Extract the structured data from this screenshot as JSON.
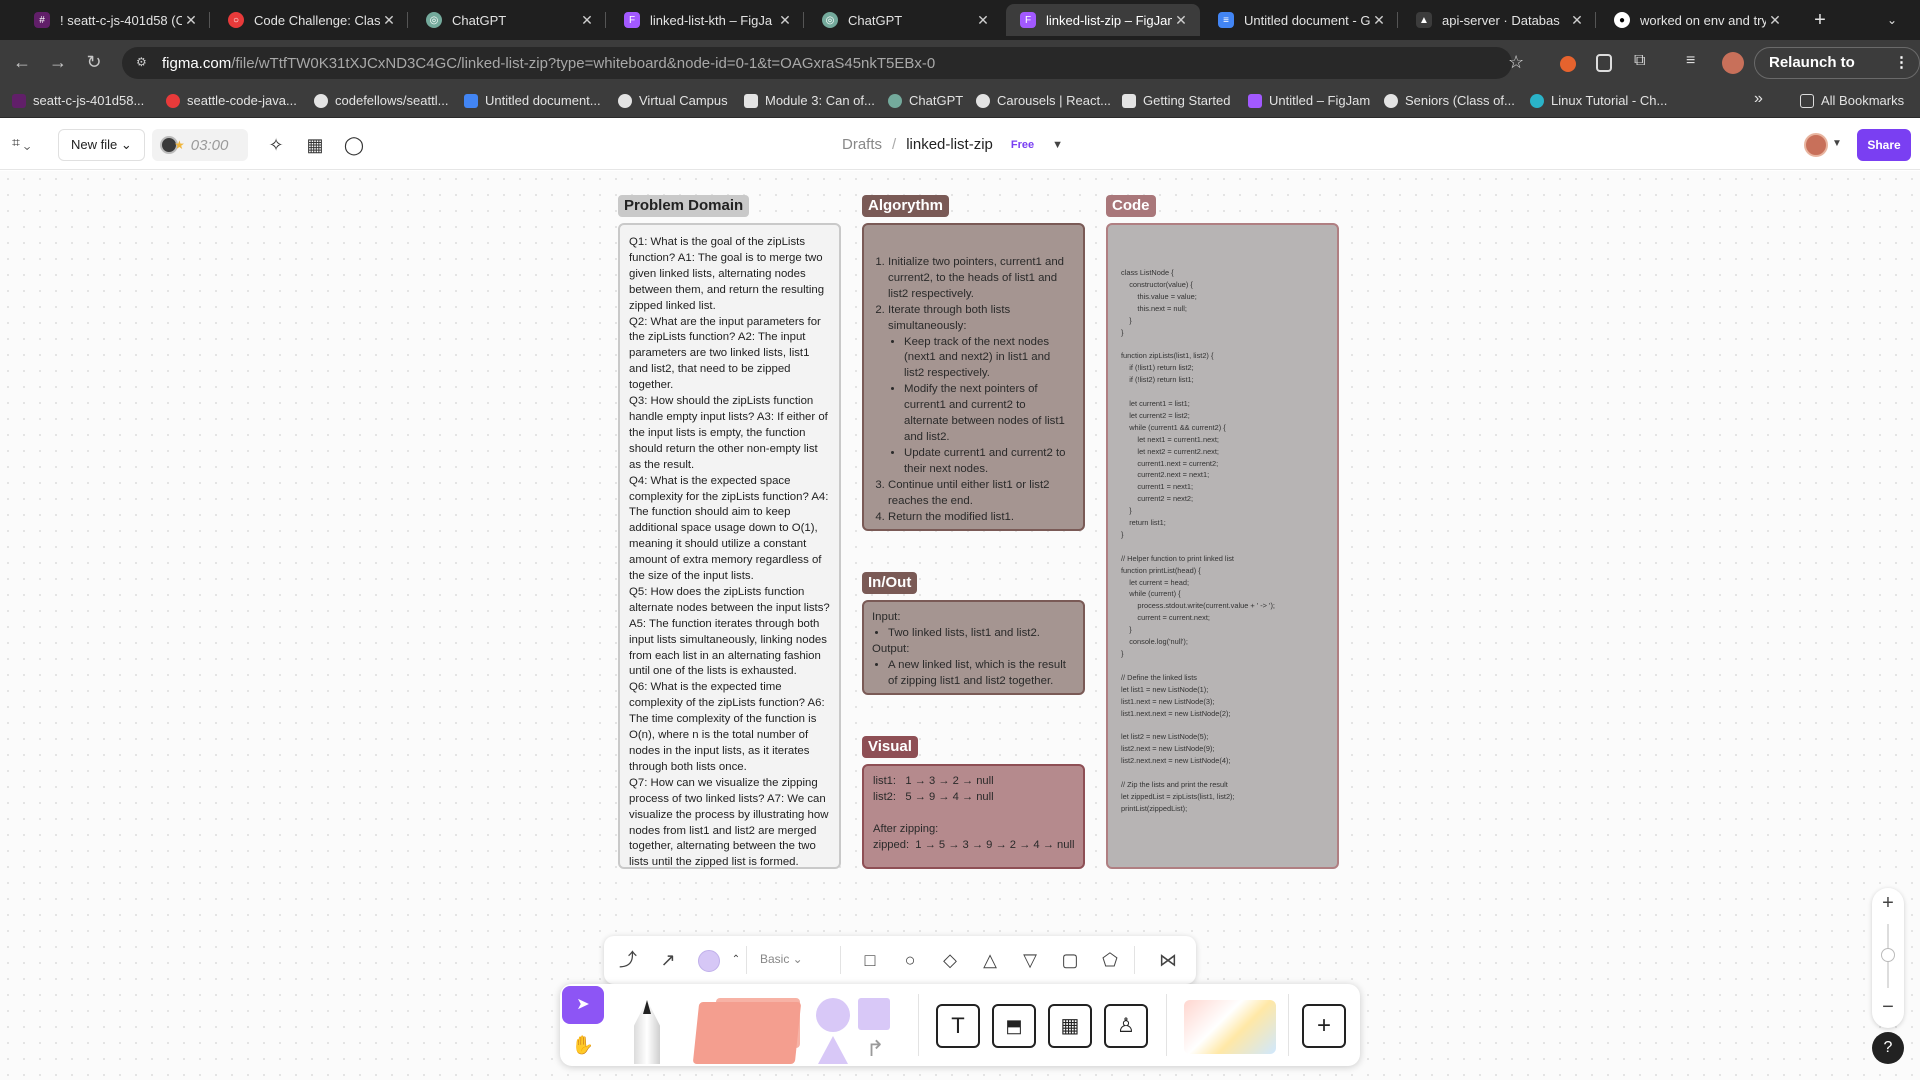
{
  "browser": {
    "tabs": [
      {
        "label": "! seatt-c-js-401d58 (C",
        "color": "#611f69",
        "glyph": "#"
      },
      {
        "label": "Code Challenge: Class",
        "color": "#e83a3a",
        "glyph": "○"
      },
      {
        "label": "ChatGPT",
        "color": "#3c3c3c",
        "glyph": "◎"
      },
      {
        "label": "linked-list-kth – FigJa",
        "color": "#a259ff",
        "glyph": "F"
      },
      {
        "label": "ChatGPT",
        "color": "#3c3c3c",
        "glyph": "◎"
      },
      {
        "label": "linked-list-zip – FigJam",
        "color": "#a259ff",
        "glyph": "F"
      },
      {
        "label": "Untitled document - G",
        "color": "#4285f4",
        "glyph": "≡"
      },
      {
        "label": "api-server · Databas",
        "color": "#3c3c3c",
        "glyph": "▲"
      },
      {
        "label": "worked on env and try",
        "color": "#3c3c3c",
        "glyph": "●"
      }
    ],
    "new_tab": "+",
    "url_host": "figma.com",
    "url_path": "/file/wTtfTW0K31tXJCxND3C4GC/linked-list-zip?type=whiteboard&node-id=0-1&t=OAGxraS45nkT5EBx-0",
    "relaunch_label": "Relaunch to update",
    "bookmarks": [
      {
        "label": "seatt-c-js-401d58...",
        "color": "#611f69"
      },
      {
        "label": "seattle-code-java...",
        "color": "#e83a3a"
      },
      {
        "label": "codefellows/seattl...",
        "color": "#e3e3e3"
      },
      {
        "label": "Untitled document...",
        "color": "#4285f4"
      },
      {
        "label": "Virtual Campus",
        "color": "#e3e3e3"
      },
      {
        "label": "Module 3: Can of...",
        "color": "#e3e3e3"
      },
      {
        "label": "ChatGPT",
        "color": "#74aa9c"
      },
      {
        "label": "Carousels | React...",
        "color": "#e3e3e3"
      },
      {
        "label": "Getting Started",
        "color": "#e3e3e3"
      },
      {
        "label": "Untitled – FigJam",
        "color": "#a259ff"
      },
      {
        "label": "Seniors (Class of...",
        "color": "#e3e3e3"
      },
      {
        "label": "Linux Tutorial - Ch...",
        "color": "#2ab3c8"
      }
    ],
    "more_bookmarks": "»",
    "all_bookmarks": "All Bookmarks"
  },
  "figma": {
    "new_file": "New file ⌄",
    "timer": "03:00",
    "breadcrumb_root": "Drafts",
    "breadcrumb_sep": "/",
    "file_name": "linked-list-zip",
    "plan_badge": "Free",
    "share_label": "Share",
    "brand_color": "#7a3ff2"
  },
  "sections": {
    "problem_domain": {
      "title": "Problem Domain",
      "text": "Q1: What is the goal of the zipLists function? A1: The goal is to merge two given linked lists, alternating nodes between them, and return the resulting zipped linked list.\nQ2: What are the input parameters for the zipLists function? A2: The input parameters are two linked lists, list1 and list2, that need to be zipped together.\nQ3: How should the zipLists function handle empty input lists? A3: If either of the input lists is empty, the function should return the other non-empty list as the result.\nQ4: What is the expected space complexity for the zipLists function? A4: The function should aim to keep additional space usage down to O(1), meaning it should utilize a constant amount of extra memory regardless of the size of the input lists.\nQ5: How does the zipLists function alternate nodes between the input lists? A5: The function iterates through both input lists simultaneously, linking nodes from each list in an alternating fashion until one of the lists is exhausted.\nQ6: What is the expected time complexity of the zipLists function? A6: The time complexity of the function is O(n), where n is the total number of nodes in the input lists, as it iterates through both lists once.\nQ7: How can we visualize the zipping process of two linked lists? A7: We can visualize the process by illustrating how nodes from list1 and list2 are merged together, alternating between the two lists until the zipped list is formed."
    },
    "algorithm": {
      "title": "Algorythm",
      "step1": "Initialize two pointers, current1 and current2, to the heads of list1 and list2 respectively.",
      "step2": "Iterate through both lists simultaneously:",
      "sub1": "Keep track of the next nodes (next1 and next2) in list1 and list2 respectively.",
      "sub2": "Modify the next pointers of current1 and current2 to alternate between nodes of list1 and list2.",
      "sub3": "Update current1 and current2 to their next nodes.",
      "step3": "Continue until either list1 or list2 reaches the end.",
      "step4": "Return the modified list1."
    },
    "in_out": {
      "title": "In/Out",
      "input_label": "Input:",
      "input_item": "Two linked lists, list1 and list2.",
      "output_label": "Output:",
      "output_item": "A new linked list, which is the result of zipping list1 and list2 together."
    },
    "visual": {
      "title": "Visual",
      "line1": "list1:   1 → 3 → 2 → null",
      "line2": "list2:   5 → 9 → 4 → null",
      "line3": "After zipping:",
      "line4": "zipped:  1 → 5 → 3 → 9 → 2 → 4 → null"
    },
    "code": {
      "title": "Code",
      "lines": [
        "class ListNode {",
        "    constructor(value) {",
        "        this.value = value;",
        "        this.next = null;",
        "    }",
        "}",
        "",
        "function zipLists(list1, list2) {",
        "    if (!list1) return list2;",
        "    if (!list2) return list1;",
        "",
        "    let current1 = list1;",
        "    let current2 = list2;",
        "    while (current1 && current2) {",
        "        let next1 = current1.next;",
        "        let next2 = current2.next;",
        "        current1.next = current2;",
        "        current2.next = next1;",
        "        current1 = next1;",
        "        current2 = next2;",
        "    }",
        "    return list1;",
        "}",
        "",
        "// Helper function to print linked list",
        "function printList(head) {",
        "    let current = head;",
        "    while (current) {",
        "        process.stdout.write(current.value + ' -> ');",
        "        current = current.next;",
        "    }",
        "    console.log('null');",
        "}",
        "",
        "// Define the linked lists",
        "let list1 = new ListNode(1);",
        "list1.next = new ListNode(3);",
        "list1.next.next = new ListNode(2);",
        "",
        "let list2 = new ListNode(5);",
        "list2.next = new ListNode(9);",
        "list2.next.next = new ListNode(4);",
        "",
        "// Zip the lists and print the result",
        "let zippedList = zipLists(list1, list2);",
        "printList(zippedList);"
      ]
    },
    "label_colors": {
      "problem_domain": "#c9c9c9",
      "algorithm": "#7a5a56",
      "in_out": "#7a5a56",
      "visual": "#8e4f55",
      "code": "#a9777a"
    }
  },
  "tools": {
    "shape_style": "Basic ⌄",
    "zoom_in": "+",
    "zoom_out": "−",
    "help": "?"
  }
}
